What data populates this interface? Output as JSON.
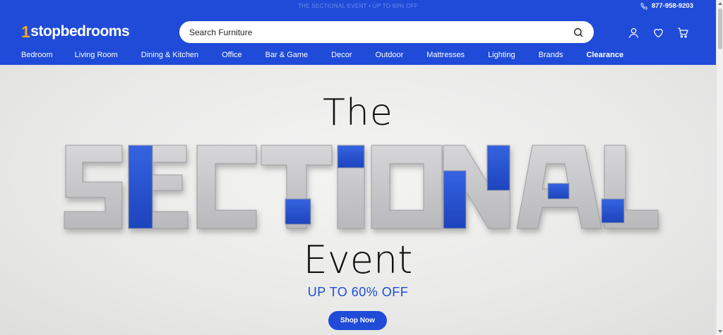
{
  "topbar": {
    "promo": "THE SECTIONAL EVENT • UP TO 60% OFF",
    "phone": "877-958-9203",
    "phone_icon": "phone-icon"
  },
  "header": {
    "logo_one": "1",
    "logo_text": "stopbedrooms",
    "search_placeholder": "Search Furniture",
    "icons": [
      "search-icon",
      "user-icon",
      "heart-icon",
      "cart-icon"
    ]
  },
  "nav": {
    "items": [
      {
        "label": "Bedroom"
      },
      {
        "label": "Living Room"
      },
      {
        "label": "Dining & Kitchen"
      },
      {
        "label": "Office"
      },
      {
        "label": "Bar & Game"
      },
      {
        "label": "Decor"
      },
      {
        "label": "Outdoor"
      },
      {
        "label": "Mattresses"
      },
      {
        "label": "Lighting"
      },
      {
        "label": "Brands"
      },
      {
        "label": "Clearance"
      }
    ]
  },
  "hero": {
    "title_top": "The",
    "title_main": "SECTIONAL",
    "title_bottom": "Event",
    "offer": "UP TO 60% OFF",
    "cta": "Shop Now"
  },
  "colors": {
    "brand_blue": "#1f4bd8",
    "logo_orange": "#f5a623",
    "sofa_gray": "#c9c9cb",
    "sofa_blue": "#2453d3"
  }
}
